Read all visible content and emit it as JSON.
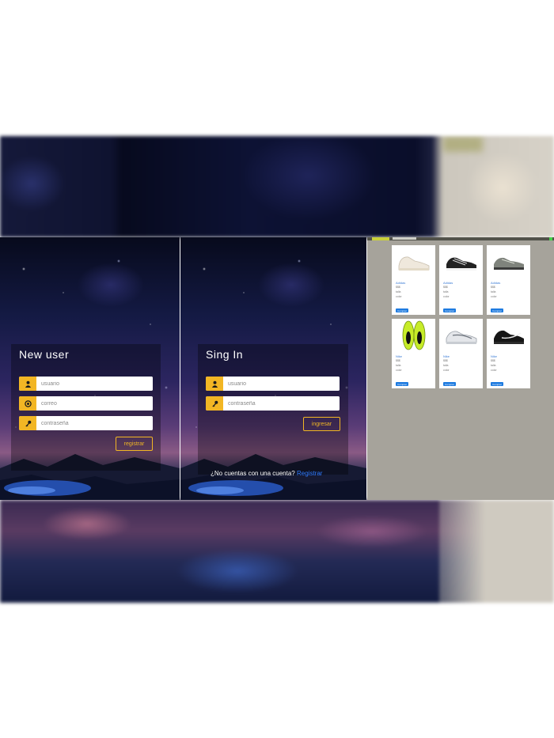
{
  "register": {
    "title": "New user",
    "user_placeholder": "usuario",
    "email_placeholder": "correo",
    "password_placeholder": "contraseña",
    "submit_label": "registrar"
  },
  "login": {
    "title": "Sing In",
    "user_placeholder": "usuario",
    "password_placeholder": "contraseña",
    "submit_label": "ingresar",
    "account_question": "¿No cuentas con una cuenta?",
    "account_link": "Registrar"
  },
  "shop": {
    "products": [
      {
        "name": "Adidas",
        "meta": [
          "$$$",
          "talla",
          "color"
        ],
        "button": "Comprar",
        "icon": "white-sneaker"
      },
      {
        "name": "Adidas",
        "meta": [
          "$$$",
          "talla",
          "color"
        ],
        "button": "Comprar",
        "icon": "black-sneaker"
      },
      {
        "name": "Adidas",
        "meta": [
          "$$$",
          "talla",
          "color"
        ],
        "button": "Comprar",
        "icon": "grey-sneaker"
      },
      {
        "name": "Nike",
        "meta": [
          "$$$",
          "talla",
          "color"
        ],
        "button": "Comprar",
        "icon": "volt-sneakers"
      },
      {
        "name": "Nike",
        "meta": [
          "$$$",
          "talla",
          "color"
        ],
        "button": "Comprar",
        "icon": "white-grey-sneaker"
      },
      {
        "name": "Nike",
        "meta": [
          "$$$",
          "talla",
          "color"
        ],
        "button": "Comprar",
        "icon": "black-nike-sneaker"
      }
    ]
  },
  "colors": {
    "accent": "#f2b624",
    "link": "#2f7bff",
    "shop_bg": "#a6a39b"
  }
}
